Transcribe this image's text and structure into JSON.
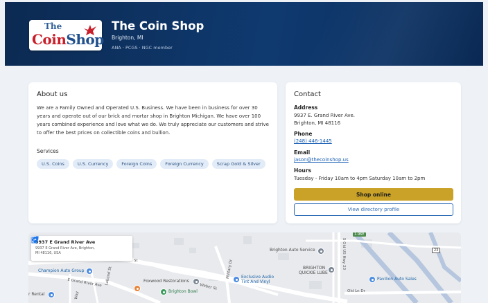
{
  "header": {
    "logo_the": "The",
    "logo_coin": "Coin",
    "logo_shop": "Shop",
    "name": "The Coin Shop",
    "location": "Brighton, MI",
    "memberships": "ANA · PCGS · NGC member"
  },
  "about": {
    "title": "About us",
    "text": "We are a Family Owned and Operated U.S. Business. We have been in business for over 30 years and operate out of our brick and mortar shop in Brighton Michigan. We have over 100 years combined experience and love what we do. We truly appreciate our customers and strive to offer the best prices on collectible coins and bullion.",
    "services_label": "Services",
    "services": [
      "U.S. Coins",
      "U.S. Currency",
      "Foreign Coins",
      "Foreign Currency",
      "Scrap Gold & Silver"
    ]
  },
  "contact": {
    "title": "Contact",
    "address_label": "Address",
    "address_line1": "9937 E. Grand River Ave.",
    "address_line2": "Brighton, MI 48116",
    "phone_label": "Phone",
    "phone": "(248) 446-1445",
    "email_label": "Email",
    "email": "jason@thecoinshop.us",
    "hours_label": "Hours",
    "hours": "Tuesday - Friday 10am to 4pm Saturday 10am to 2pm",
    "shop_button": "Shop online",
    "directory_button": "View directory profile"
  },
  "map": {
    "popup_title": "9937 E Grand River Ave",
    "popup_address": "9937 E Grand River Ave, Brighton, MI 48116, USA",
    "places": {
      "brighton_auto": "Brighton Auto Service",
      "brighton_quickie_1": "BRIGHTON",
      "brighton_quickie_2": "QUICKIE LUBE",
      "champion": "Champion Auto Group",
      "foxwood": "Foxwood Restorations",
      "exclusive_1": "Exclusive Audio",
      "exclusive_2": "Tint And Vinyl",
      "pavilion": "Pavilion Auto Sales",
      "brighton_bowl": "Brighton Bowl",
      "rental": "r Rental"
    },
    "roads": {
      "grand_river": "E Grand River Ave",
      "weber": "Weber St",
      "military": "Military Dr",
      "old_us_23": "S Old US Hwy 23",
      "old_ln": "Old Ln Dr",
      "st": "St",
      "labond": "Labond St",
      "way": "Way"
    },
    "shields": {
      "hwy_23": "23",
      "exit": "1-96E"
    }
  },
  "colors": {
    "header_bg": "#0f3a70",
    "accent_gold": "#c9a227",
    "link_blue": "#1a5fb4",
    "chip_bg": "#e2ecf8"
  }
}
